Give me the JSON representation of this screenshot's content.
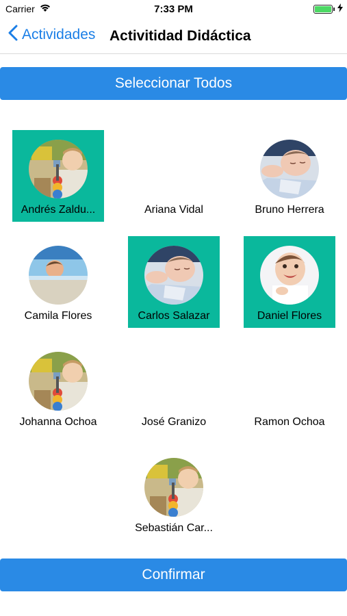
{
  "status_bar": {
    "carrier": "Carrier",
    "time": "7:33 PM"
  },
  "nav": {
    "back_label": "Actividades",
    "title": "Activitidad Didáctica"
  },
  "select_all_label": "Seleccionar Todos",
  "confirm_label": "Confirmar",
  "colors": {
    "accent_blue": "#2a8ae5",
    "selected_teal": "#0ab89c"
  },
  "students": [
    {
      "name": "Andrés  Zaldu...",
      "selected": true,
      "photo": "toy-baby"
    },
    {
      "name": "Ariana Vidal",
      "selected": false,
      "photo": "none"
    },
    {
      "name": "Bruno  Herrera",
      "selected": false,
      "photo": "sleeping-baby"
    },
    {
      "name": "Camila Flores",
      "selected": false,
      "photo": "pool-child"
    },
    {
      "name": "Carlos Salazar",
      "selected": true,
      "photo": "sleeping-baby"
    },
    {
      "name": "Daniel Flores",
      "selected": true,
      "photo": "smiling-baby"
    },
    {
      "name": "Johanna  Ochoa",
      "selected": false,
      "photo": "toy-baby"
    },
    {
      "name": "José Granizo",
      "selected": false,
      "photo": "none"
    },
    {
      "name": "Ramon Ochoa",
      "selected": false,
      "photo": "none"
    },
    {
      "name": "Sebastián  Car...",
      "selected": false,
      "photo": "toy-baby"
    }
  ]
}
